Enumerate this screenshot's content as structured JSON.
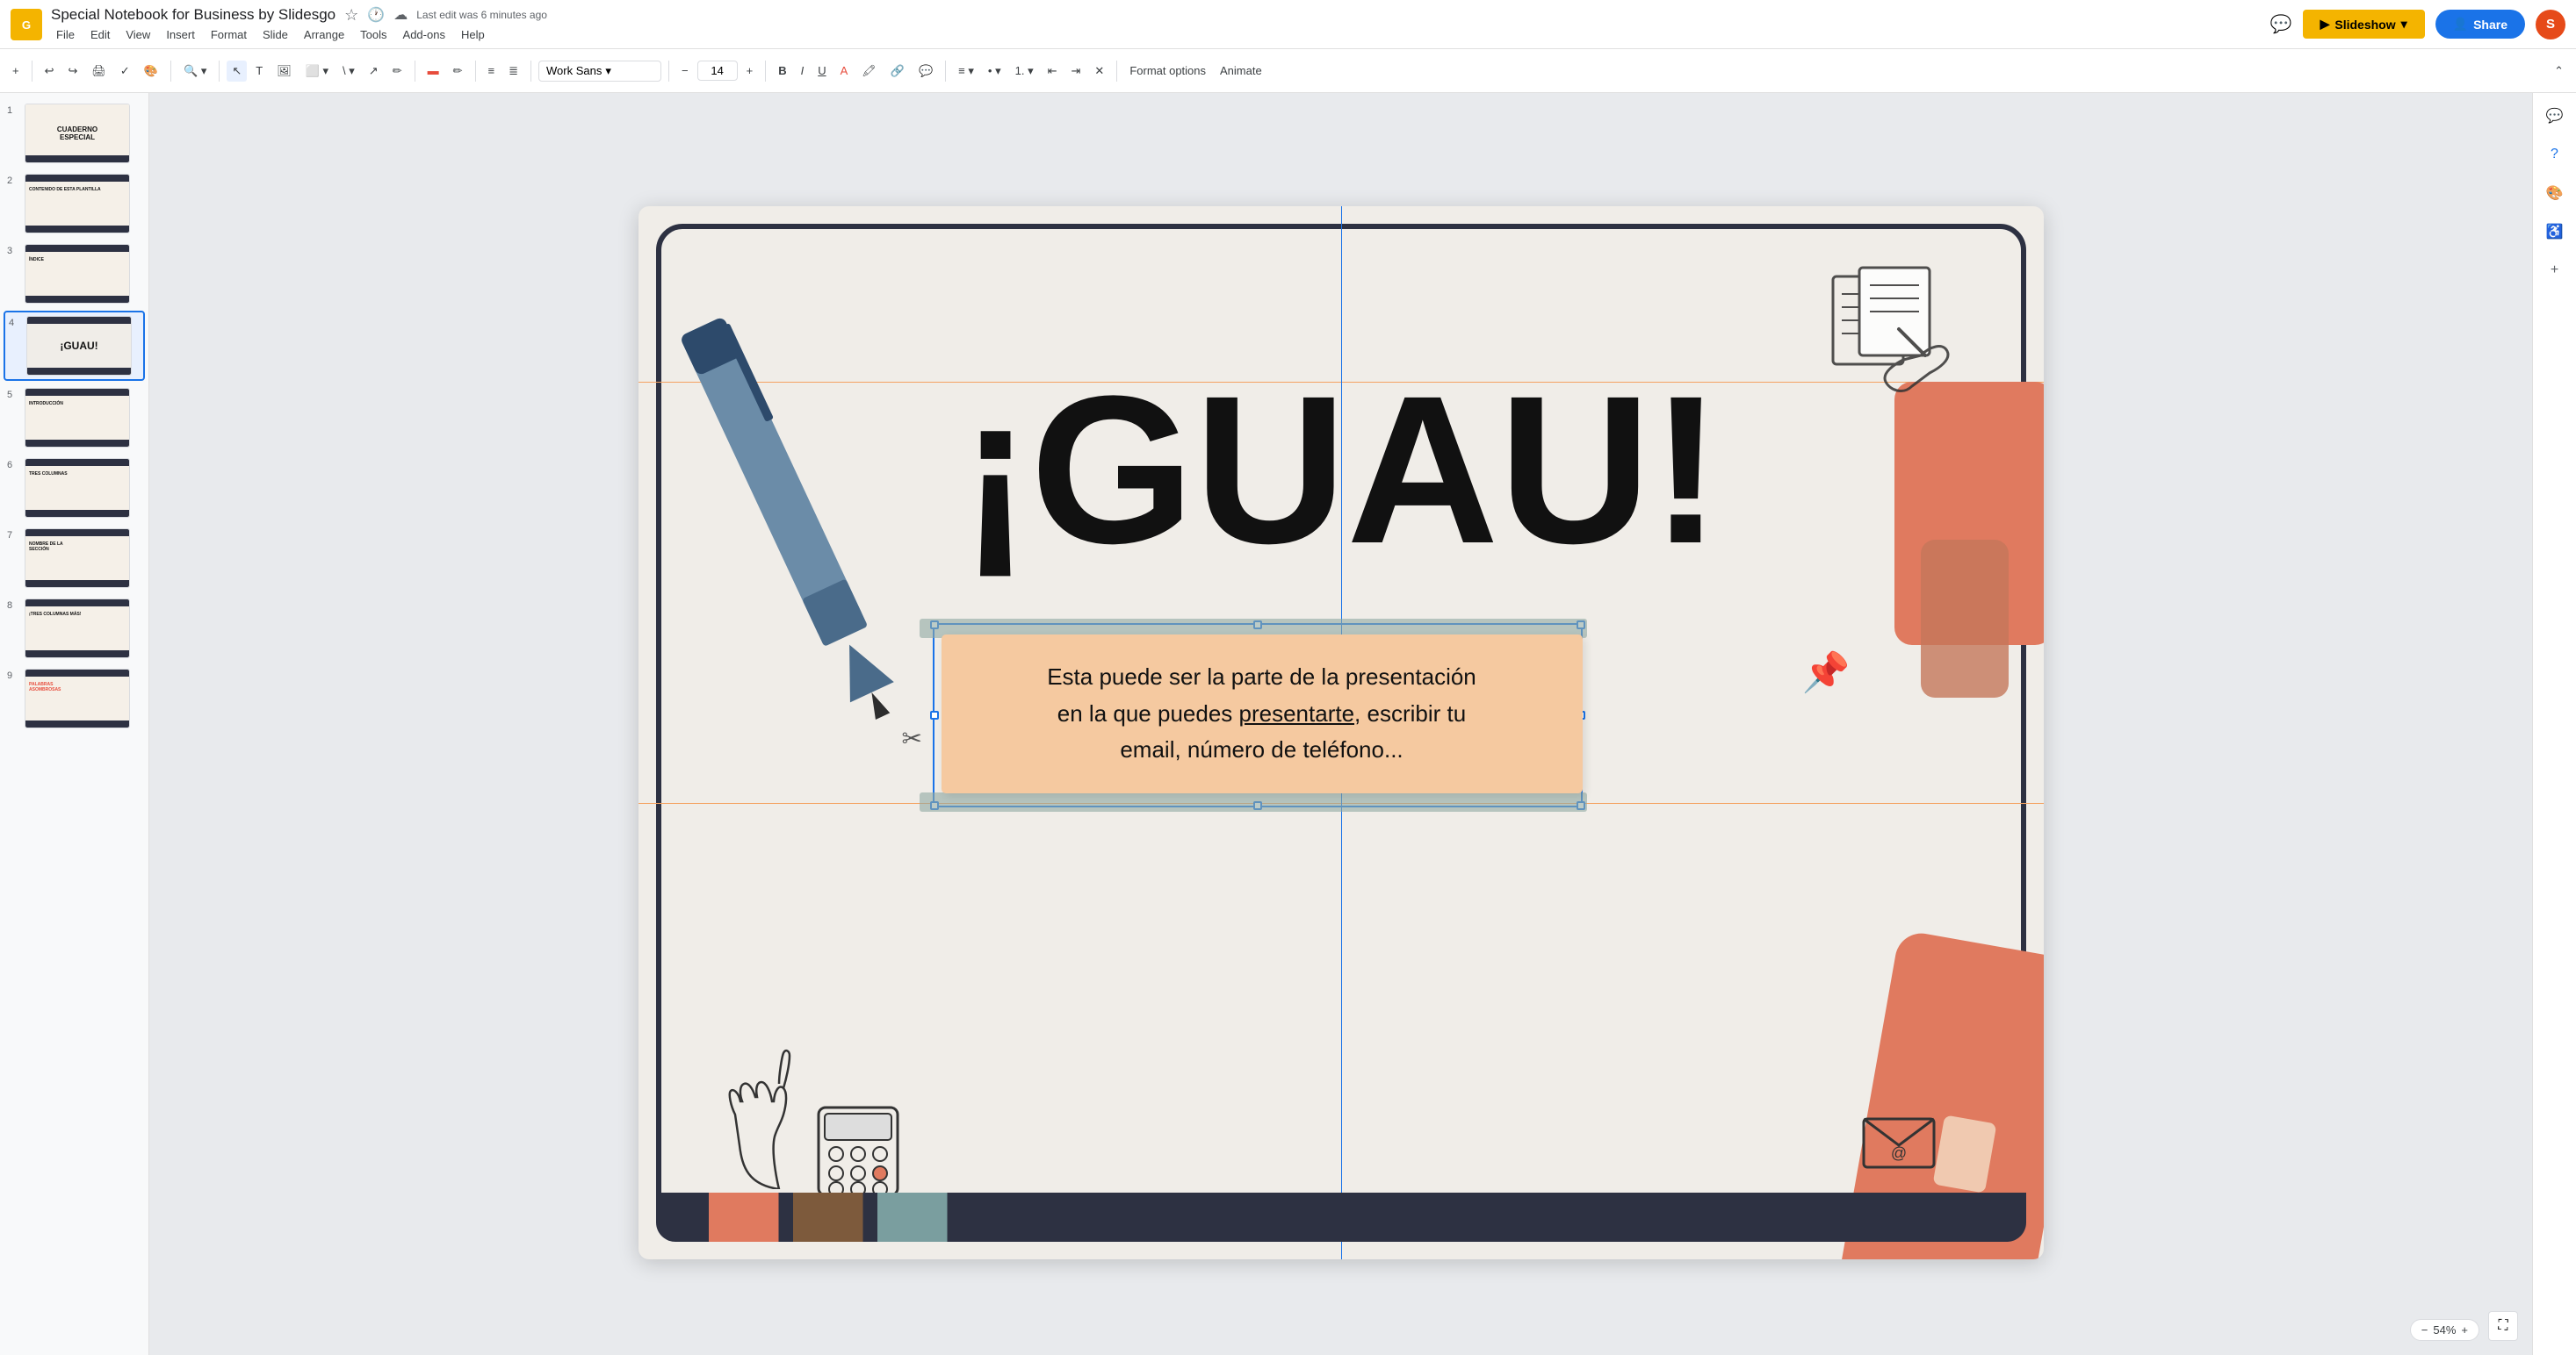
{
  "app": {
    "logo": "G",
    "title": "Special Notebook for Business by Slidesgo",
    "last_edit": "Last edit was 6 minutes ago"
  },
  "menu": {
    "items": [
      "File",
      "Edit",
      "View",
      "Insert",
      "Format",
      "Slide",
      "Arrange",
      "Tools",
      "Add-ons",
      "Help"
    ]
  },
  "toolbar": {
    "font_name": "Work Sans",
    "font_size": "14",
    "format_options": "Format options",
    "animate": "Animate"
  },
  "slideshow_btn": "Slideshow",
  "share_btn": "Share",
  "user_initial": "S",
  "slides": [
    {
      "num": "1",
      "label": ""
    },
    {
      "num": "2",
      "label": "CONTENIDO DE ESTA PLANTILLA"
    },
    {
      "num": "3",
      "label": "ÍNDICE"
    },
    {
      "num": "4",
      "label": "¡GUAU!"
    },
    {
      "num": "5",
      "label": "INTRODUCCIÓN"
    },
    {
      "num": "6",
      "label": "TRES COLUMNAS"
    },
    {
      "num": "7",
      "label": "NOMBRE DE LA SECCIÓN"
    },
    {
      "num": "8",
      "label": "¡TRES COLUMNAS MÁS!"
    },
    {
      "num": "9",
      "label": "PALABRAS ASOMBROSAS"
    }
  ],
  "slide_content": {
    "title": "¡GUAU!",
    "sticky_text": "Esta puede ser la parte de la presentación en la que puedes presentarte, escribir tu email, número de teléfono...",
    "sticky_underline_word": "presentarte"
  },
  "zoom": {
    "level": "54%"
  }
}
